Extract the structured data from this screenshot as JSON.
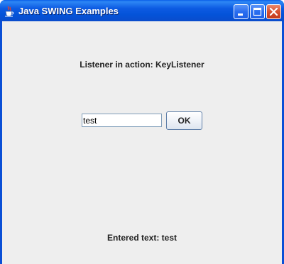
{
  "window": {
    "title": "Java SWING Examples",
    "app_icon": "java-cup-icon",
    "controls": {
      "minimize_icon": "minimize-icon",
      "maximize_icon": "maximize-icon",
      "close_icon": "close-icon"
    },
    "colors": {
      "titlebar": "#0a54dc",
      "close_button": "#d6502f",
      "content_background": "#eeeeee"
    }
  },
  "main": {
    "heading": "Listener in action: KeyListener",
    "input": {
      "value": "test"
    },
    "ok_button_label": "OK",
    "status": {
      "label": "Entered text: ",
      "value": "test"
    }
  }
}
